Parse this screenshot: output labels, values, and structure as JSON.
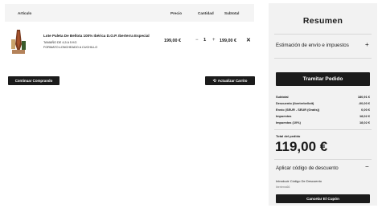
{
  "cart": {
    "headers": {
      "article": "Artículo",
      "price": "Precio",
      "quantity": "Cantidad",
      "subtotal": "Subtotal"
    },
    "item": {
      "name": "Lote Paleta De Bellota 100% Ibérica D.O.P. Iberterra Especial",
      "attr1": "TAMAÑO DE 4,5 A 5 KG",
      "attr2": "FORMATO:LONCHEADO A CUCHILLO",
      "price": "199,00 €",
      "quantity": "1",
      "minus": "−",
      "plus": "+",
      "subtotal": "199,00 €",
      "remove": "✕"
    },
    "continue_label": "Continuar Comprando",
    "update_label": "Actualizar Carrito",
    "update_icon": "refresh-icon"
  },
  "summary": {
    "title": "Resumen",
    "shipping_label": "Estimación de envío e impuestos",
    "shipping_toggle": "+",
    "checkout_label": "Tramitar Pedido",
    "totals": [
      {
        "label": "Subtotal",
        "value": "180,91 €"
      },
      {
        "label": "Descuento (iberterbellott)",
        "value": "-00,00 €"
      },
      {
        "label": "Envío (SEUR - SEUR (Gratis))",
        "value": "0,00 €"
      },
      {
        "label": "Impuestos",
        "value": "18,02 €"
      },
      {
        "label": "Impuestos (10%)",
        "value": "18,02 €"
      }
    ],
    "order_total_label": "Total del pedido",
    "order_total": "119,00 €",
    "discount_label": "Aplicar código de descuento",
    "discount_toggle": "−",
    "code_label": "Introducir Código De Descuento",
    "code_placeholder": "iberterra66",
    "coupon_button": "Cancelar El Cupón"
  }
}
